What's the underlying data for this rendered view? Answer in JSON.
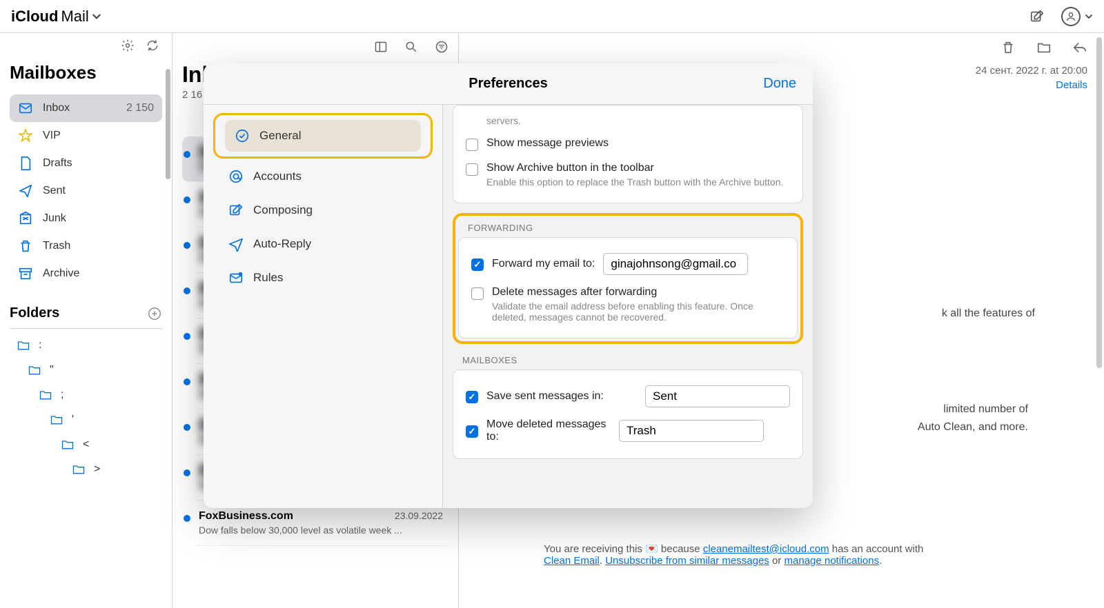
{
  "app": {
    "brand_prefix": "iCloud",
    "brand_word": "Mail"
  },
  "sidebar": {
    "title": "Mailboxes",
    "items": [
      {
        "label": "Inbox",
        "count": "2 150"
      },
      {
        "label": "VIP"
      },
      {
        "label": "Drafts"
      },
      {
        "label": "Sent"
      },
      {
        "label": "Junk"
      },
      {
        "label": "Trash"
      },
      {
        "label": "Archive"
      }
    ],
    "folders_title": "Folders",
    "folders": [
      {
        "label": ":"
      },
      {
        "label": "\""
      },
      {
        "label": ";"
      },
      {
        "label": "'"
      },
      {
        "label": "<"
      },
      {
        "label": ">"
      }
    ]
  },
  "msglist": {
    "title_partial": "Inb",
    "count_partial": "2 16",
    "items": [
      {
        "sender": "FoxBusiness.com",
        "date": "23.09.2022",
        "preview": "Dow falls below 30,000 level as volatile week ..."
      }
    ]
  },
  "message": {
    "date": "24 сент. 2022 г. at 20:00",
    "details": "Details",
    "partial1": "k all the features of",
    "partial2": "limited number of",
    "partial3": "Auto Clean, and more.",
    "footer_prefix": "You are receiving this 💌 because ",
    "footer_email": "cleanemailtest@icloud.com",
    "footer_has": " has an account with ",
    "footer_clean": "Clean Email",
    "footer_dot": ". ",
    "footer_unsub": "Unsubscribe from similar messages",
    "footer_or": " or ",
    "footer_manage": "manage notifications",
    "footer_end": "."
  },
  "modal": {
    "title": "Preferences",
    "done": "Done",
    "tabs": {
      "general": "General",
      "accounts": "Accounts",
      "composing": "Composing",
      "autoreply": "Auto-Reply",
      "rules": "Rules"
    },
    "partial_top": "servers.",
    "previews": "Show message previews",
    "archive_btn": "Show Archive button in the toolbar",
    "archive_help": "Enable this option to replace the Trash button with the Archive button.",
    "forwarding_title": "FORWARDING",
    "fwd_label": "Forward my email to:",
    "fwd_value": "ginajohnsong@gmail.co",
    "delete_fwd": "Delete messages after forwarding",
    "delete_fwd_help": "Validate the email address before enabling this feature. Once deleted, messages cannot be recovered.",
    "mailboxes_title": "MAILBOXES",
    "save_sent": "Save sent messages in:",
    "save_sent_value": "Sent",
    "move_deleted": "Move deleted messages to:",
    "move_deleted_value": "Trash"
  }
}
